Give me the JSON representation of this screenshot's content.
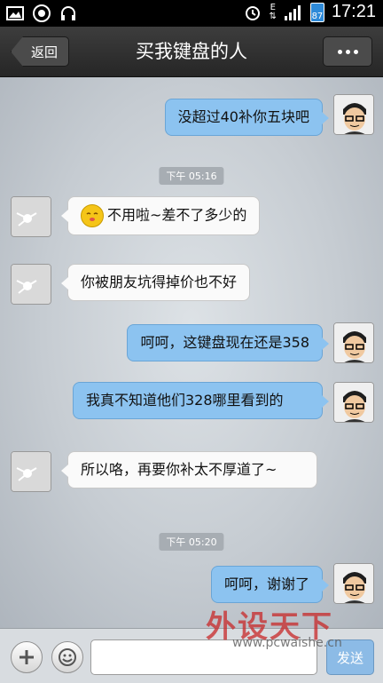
{
  "status_bar": {
    "time": "17:21",
    "network_type": "E",
    "battery": "87",
    "icons": [
      "gallery-icon",
      "chrome-icon",
      "headset-icon",
      "alarm-icon",
      "data-arrows-icon",
      "signal-icon",
      "battery-icon"
    ]
  },
  "header": {
    "back_label": "返回",
    "title": "买我键盘的人",
    "more_icon": "more-dots-icon"
  },
  "messages": [
    {
      "side": "out",
      "text": "没超过40补你五块吧"
    },
    {
      "type": "time",
      "text": "下午 05:16"
    },
    {
      "side": "in",
      "emoji": "shy-face-emoji",
      "text": "不用啦~差不了多少的"
    },
    {
      "side": "in",
      "text": "你被朋友坑得掉价也不好"
    },
    {
      "side": "out",
      "text": "呵呵，这键盘现在还是358"
    },
    {
      "side": "out",
      "text": "我真不知道他们328哪里看到的"
    },
    {
      "side": "in",
      "text": "所以咯，再要你补太不厚道了~"
    },
    {
      "type": "time",
      "text": "下午 05:20"
    },
    {
      "side": "out",
      "text": "呵呵，谢谢了"
    }
  ],
  "input_bar": {
    "plus_icon": "plus-icon",
    "emoji_icon": "smiley-icon",
    "input_value": "",
    "send_label": "发送"
  },
  "watermark": {
    "text": "外设天下",
    "url": "www.pcwaishe.cn"
  },
  "colors": {
    "outgoing_bubble": "#8cc3f0",
    "incoming_bubble": "#fafafa",
    "header": "#2f2f2f"
  }
}
